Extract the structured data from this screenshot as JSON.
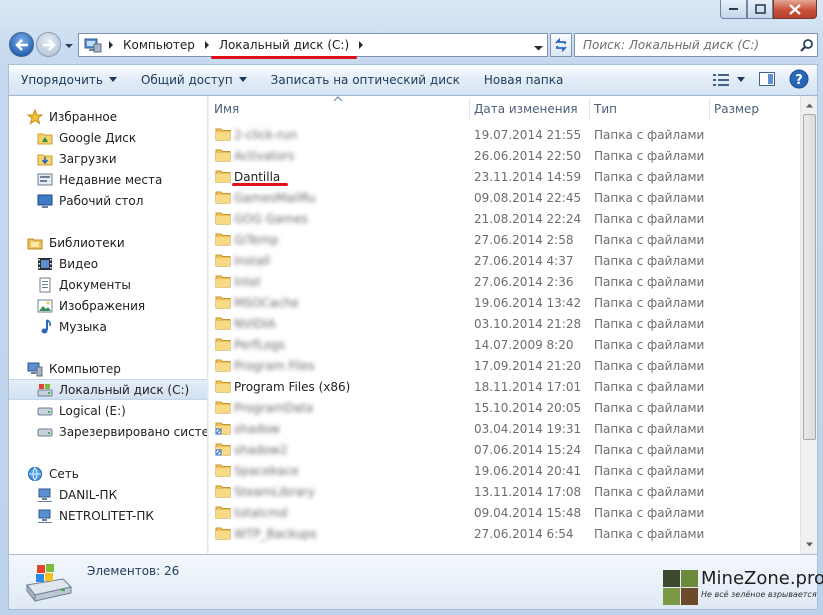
{
  "address": {
    "crumbs": [
      "Компьютер",
      "Локальный диск (C:)"
    ]
  },
  "search": {
    "placeholder": "Поиск: Локальный диск (C:)"
  },
  "toolbar": {
    "organize": "Упорядочить",
    "share": "Общий доступ",
    "burn": "Записать на оптический диск",
    "new_folder": "Новая папка"
  },
  "nav": {
    "favorites": "Избранное",
    "google_drive": "Google Диск",
    "downloads": "Загрузки",
    "recent": "Недавние места",
    "desktop": "Рабочий стол",
    "libraries": "Библиотеки",
    "video": "Видео",
    "documents": "Документы",
    "images": "Изображения",
    "music": "Музыка",
    "computer": "Компьютер",
    "local_c": "Локальный диск (C:)",
    "logical_e": "Logical (E:)",
    "reserved": "Зарезервировано системой",
    "network": "Сеть",
    "pc1": "DANIL-ПК",
    "pc2": "NETROLITET-ПК"
  },
  "columns": {
    "name": "Имя",
    "date": "Дата изменения",
    "type": "Тип",
    "size": "Размер"
  },
  "files": [
    {
      "name": "2-click-run",
      "date": "19.07.2014 21:55",
      "type": "Папка с файлами"
    },
    {
      "name": "Activators",
      "date": "26.06.2014 22:50",
      "type": "Папка с файлами"
    },
    {
      "name": "Dantilla",
      "date": "23.11.2014 14:59",
      "type": "Папка с файлами"
    },
    {
      "name": "GamesMailRu",
      "date": "09.08.2014 22:45",
      "type": "Папка с файлами"
    },
    {
      "name": "GOG Games",
      "date": "21.08.2014 22:24",
      "type": "Папка с файлами"
    },
    {
      "name": "GiTemp",
      "date": "27.06.2014 2:58",
      "type": "Папка с файлами"
    },
    {
      "name": "Install",
      "date": "27.06.2014 4:37",
      "type": "Папка с файлами"
    },
    {
      "name": "Intel",
      "date": "27.06.2014 2:36",
      "type": "Папка с файлами"
    },
    {
      "name": "MSOCache",
      "date": "19.06.2014 13:42",
      "type": "Папка с файлами"
    },
    {
      "name": "NVIDIA",
      "date": "03.10.2014 21:28",
      "type": "Папка с файлами"
    },
    {
      "name": "PerfLogs",
      "date": "14.07.2009 8:20",
      "type": "Папка с файлами"
    },
    {
      "name": "Program Files",
      "date": "17.09.2014 21:20",
      "type": "Папка с файлами"
    },
    {
      "name": "Program Files (x86)",
      "date": "18.11.2014 17:01",
      "type": "Папка с файлами"
    },
    {
      "name": "ProgramData",
      "date": "15.10.2014 20:05",
      "type": "Папка с файлами"
    },
    {
      "name": "shadow",
      "date": "03.04.2014 19:31",
      "type": "Папка с файлами"
    },
    {
      "name": "shadow2",
      "date": "07.06.2014 15:24",
      "type": "Папка с файлами"
    },
    {
      "name": "Spacekace",
      "date": "19.06.2014 20:41",
      "type": "Папка с файлами"
    },
    {
      "name": "SteamLibrary",
      "date": "13.11.2014 17:08",
      "type": "Папка с файлами"
    },
    {
      "name": "totalcmd",
      "date": "09.04.2014 15:48",
      "type": "Папка с файлами"
    },
    {
      "name": "WTP_Backups",
      "date": "27.06.2014 6:54",
      "type": "Папка с файлами"
    }
  ],
  "details": {
    "count": "Элементов: 26"
  },
  "watermark": {
    "title": "MineZone.pro",
    "subtitle": "Не всё зелёное взрывается"
  }
}
